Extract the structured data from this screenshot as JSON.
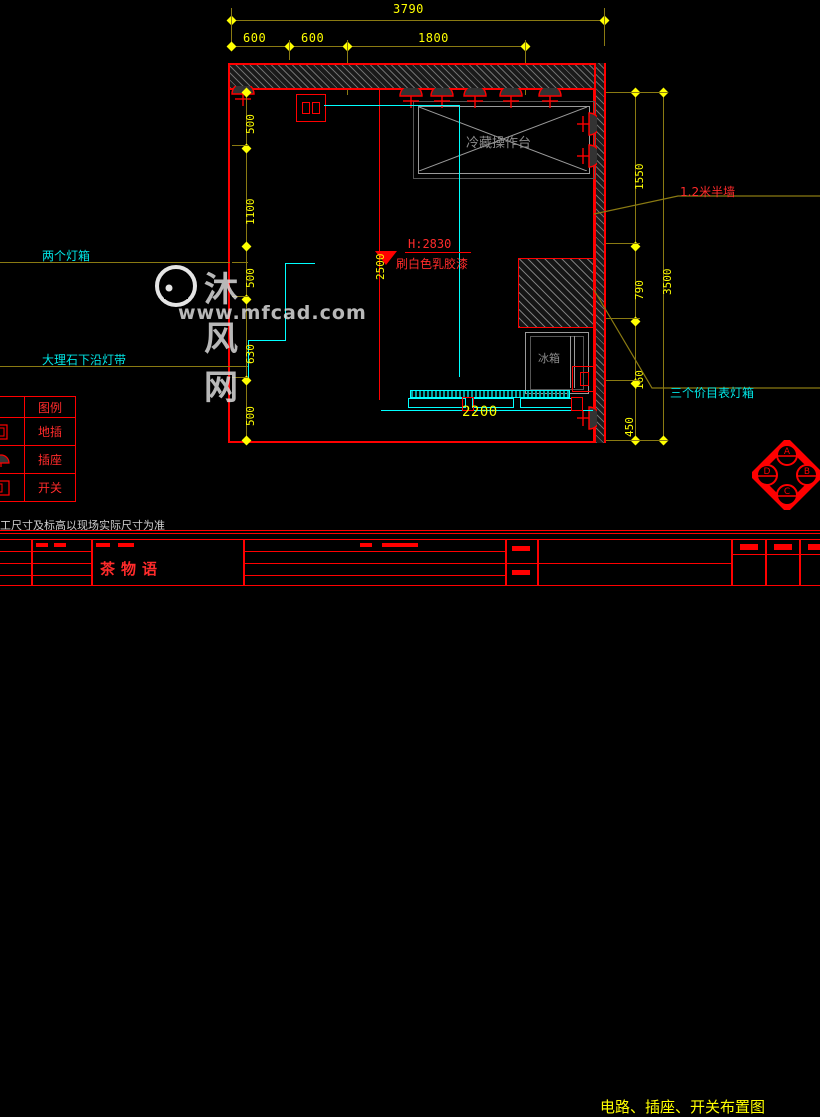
{
  "drawing": {
    "title": "电路、插座、开关布置图",
    "project_name": "茶物语",
    "note": "工尺寸及标高以现场实际尺寸为准"
  },
  "colors": {
    "dimension": "#ffff00",
    "wall": "#ff0000",
    "wiring": "#00ffff",
    "annotation_cyan": "#00e5e5",
    "annotation_red": "#ff2b2b",
    "leader": "#8a7a12",
    "background": "#000000",
    "hatch": "#6e6e6e"
  },
  "dimensions": {
    "top_overall": "3790",
    "top_chain": [
      "600",
      "600",
      "1800"
    ],
    "left_chain": [
      "500",
      "1100",
      "500",
      "630",
      "500"
    ],
    "right_chain": [
      "1550",
      "790",
      "160",
      "450"
    ],
    "right_overall": "3500",
    "bottom_counter": "2200"
  },
  "annotations": {
    "left": [
      {
        "label": "两个灯箱"
      },
      {
        "label": "大理石下沿灯带"
      }
    ],
    "right": [
      {
        "label": "1.2米半墙"
      },
      {
        "label": "三个价目表灯箱"
      }
    ],
    "ceiling_height": "H:2830",
    "ceiling_finish": "刷白色乳胶漆",
    "equipment": [
      {
        "label": "冷藏操作台"
      },
      {
        "label": "冰箱"
      }
    ],
    "room_height_tag": "2500"
  },
  "legend": {
    "header": "图例",
    "rows": [
      {
        "symbol": "floor-socket-icon",
        "label": "地插"
      },
      {
        "symbol": "wall-socket-icon",
        "label": "插座"
      },
      {
        "symbol": "switch-icon",
        "label": "开关"
      }
    ]
  },
  "elevation_marker": {
    "labels": [
      "A",
      "B",
      "C",
      "D"
    ]
  },
  "watermark": {
    "text": "沐风网",
    "url": "www.mfcad.com"
  }
}
